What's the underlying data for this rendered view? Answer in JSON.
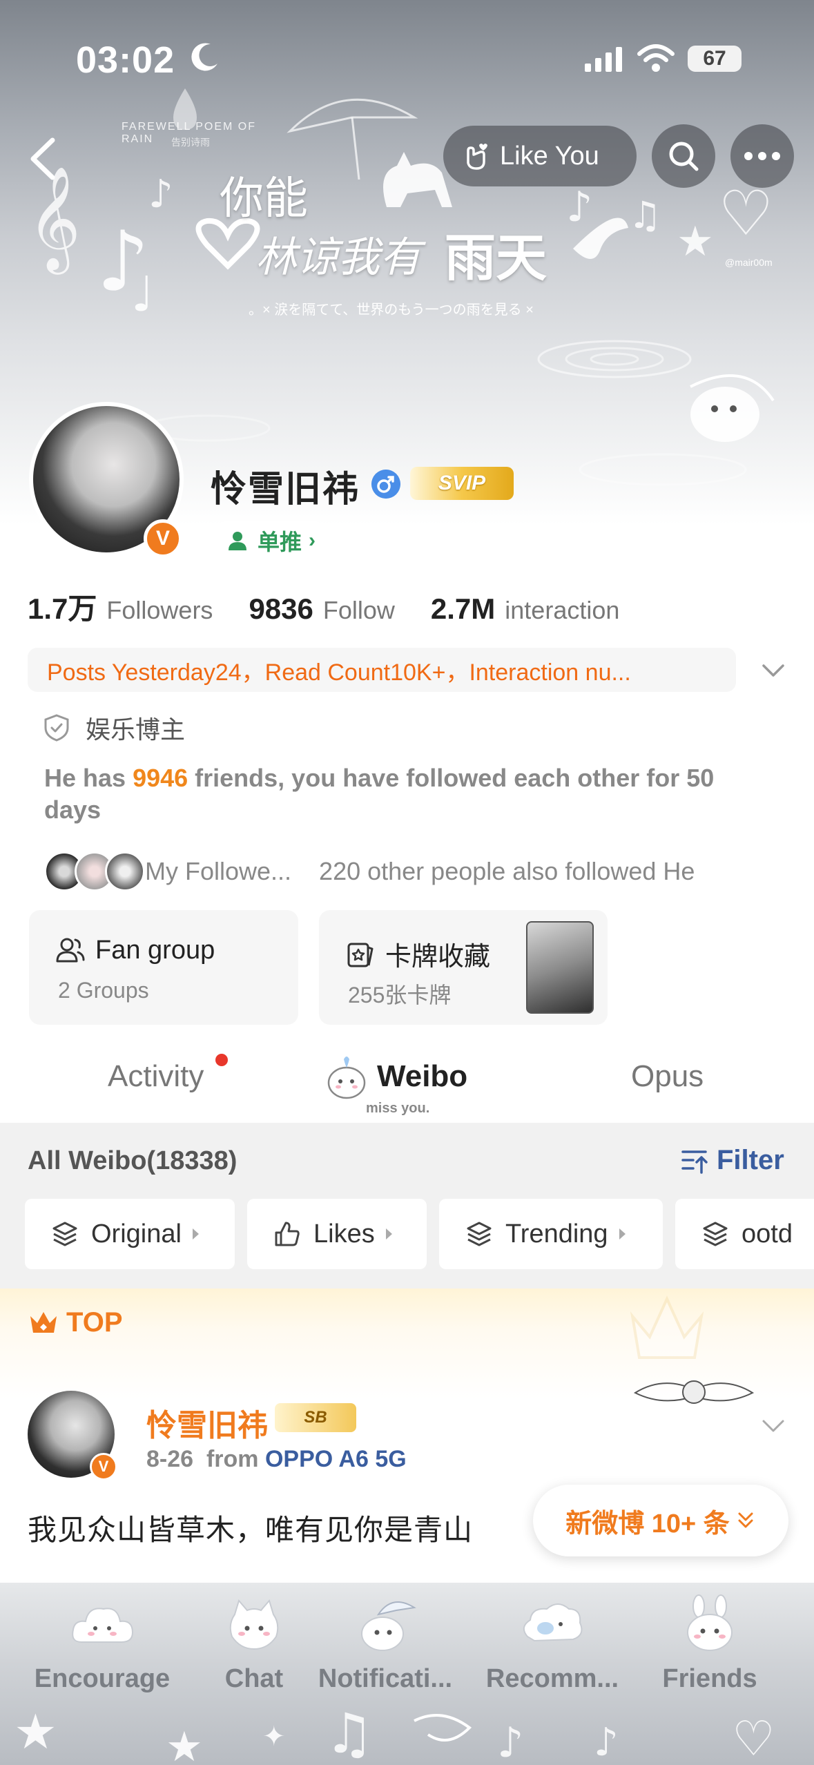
{
  "status_bar": {
    "time": "03:02",
    "battery": "67"
  },
  "banner": {
    "like_button": "Like You",
    "title_part1": "你能",
    "title_part2": "林谅我有",
    "title_part3": "雨天",
    "subtitle": "。× 涙を隔てて、世界のもう一つの雨を見る ×",
    "watermark_top": "FAREWELL POEM OF RAIN",
    "watermark_sub": "告别诗雨",
    "handle": "@mair00m"
  },
  "profile": {
    "name": "怜雪旧祎",
    "vip": "SVIP",
    "verified_mark": "V",
    "tag": "单推",
    "stats": [
      {
        "value": "1.7万",
        "label": "Followers"
      },
      {
        "value": "9836",
        "label": "Follow"
      },
      {
        "value": "2.7M",
        "label": "interaction"
      }
    ],
    "summary": "Posts Yesterday24，Read Count10K+，Interaction nu...",
    "category": "娱乐博主",
    "friends_prefix": "He has ",
    "friends_count": "9946",
    "friends_suffix": " friends, you have followed each other for 50 days",
    "my_followers": "My Followe...",
    "others_followed": "220 other people also followed He"
  },
  "cards": {
    "fan_group": {
      "title": "Fan group",
      "sub": "2 Groups"
    },
    "collection": {
      "title": "卡牌收藏",
      "sub": "255张卡牌"
    }
  },
  "tabs": {
    "activity": "Activity",
    "weibo": "Weibo",
    "opus": "Opus",
    "deco": "miss you."
  },
  "feed": {
    "header": "All Weibo(18338)",
    "filter": "Filter",
    "chips": [
      "Original",
      "Likes",
      "Trending",
      "ootd"
    ]
  },
  "post": {
    "top_label": "TOP",
    "author": "怜雪旧祎",
    "level": "SB",
    "date": "8-26",
    "from_label": "from",
    "source": "OPPO A6 5G",
    "text": "我见众山皆草木，唯有见你是青山",
    "new_posts": "新微博 10+ 条"
  },
  "bottom_nav": [
    "Encourage",
    "Chat",
    "Notificati...",
    "Recomm...",
    "Friends"
  ],
  "colors": {
    "accent_orange": "#f07b1e",
    "link_blue": "#3a5d9f",
    "tag_green": "#2f9a5a"
  }
}
